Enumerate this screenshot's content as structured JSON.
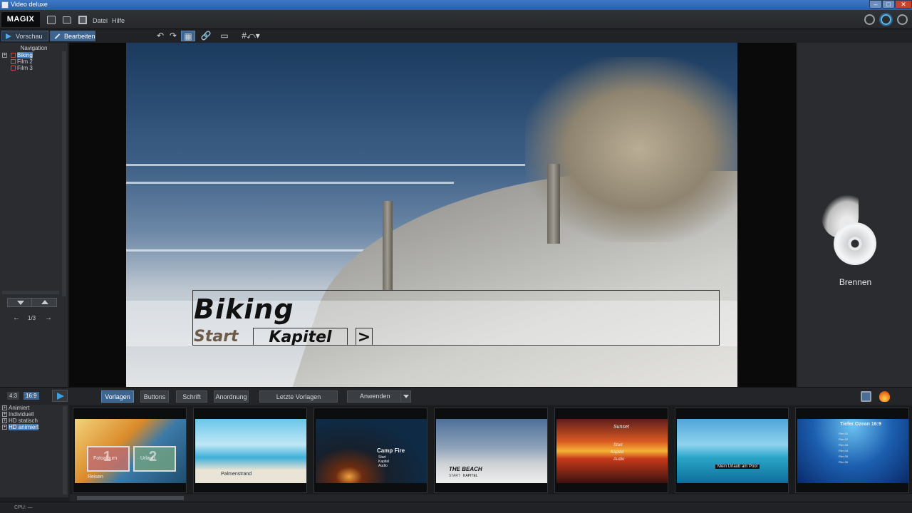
{
  "window": {
    "title": "Video deluxe"
  },
  "menubar": {
    "logo": "MAGIX",
    "file_menu": "Datei",
    "help_menu": "Hilfe"
  },
  "modebar": {
    "preview_tab": "Vorschau",
    "edit_tab": "Bearbeiten"
  },
  "navigation": {
    "title": "Navigation",
    "items": [
      {
        "label": "Biking",
        "selected": true
      },
      {
        "label": "Film 2",
        "selected": false
      },
      {
        "label": "Film 3",
        "selected": false
      }
    ],
    "pager": "1/3"
  },
  "dvd_menu": {
    "title": "Biking",
    "buttons": {
      "start": "Start",
      "kapitel": "Kapitel",
      "next": ">"
    }
  },
  "burn": {
    "label": "Brennen"
  },
  "template_bar": {
    "ratio_4_3": "4:3",
    "ratio_16_9": "16:9",
    "tabs": [
      "Vorlagen",
      "Buttons",
      "Schrift",
      "Anordnung",
      "Letzte Vorlagen"
    ],
    "apply_label": "Anwenden"
  },
  "categories": [
    {
      "label": "Animiert",
      "selected": false
    },
    {
      "label": "Individuell",
      "selected": false
    },
    {
      "label": "HD statisch",
      "selected": false
    },
    {
      "label": "HD animiert",
      "selected": true
    }
  ],
  "thumbnails": [
    {
      "caption_main": "Reisen",
      "caption_a": "Fotoalbum",
      "caption_b": "Urlaub"
    },
    {
      "caption_main": "Palmenstrand"
    },
    {
      "caption_main": "Camp Fire",
      "lines": [
        "Start",
        "Kapitel",
        "Audio"
      ]
    },
    {
      "caption_main": "THE BEACH",
      "lines": [
        "START",
        "KAPITEL"
      ]
    },
    {
      "caption_main": "Sunset",
      "lines": [
        "Start",
        "Kapitel",
        "Audio"
      ]
    },
    {
      "caption_main": "Mein Urlaub am Pool"
    },
    {
      "caption_main": "Tiefer Ozean 16:9",
      "lines": [
        "Film 01",
        "Film 02",
        "Film 03",
        "Film 04",
        "Film 05",
        "Film 06"
      ]
    }
  ],
  "status": {
    "cpu": "CPU: —"
  },
  "colors": {
    "accent": "#3e6590",
    "selection": "#3f78b8",
    "tree_box": "#d04848"
  }
}
